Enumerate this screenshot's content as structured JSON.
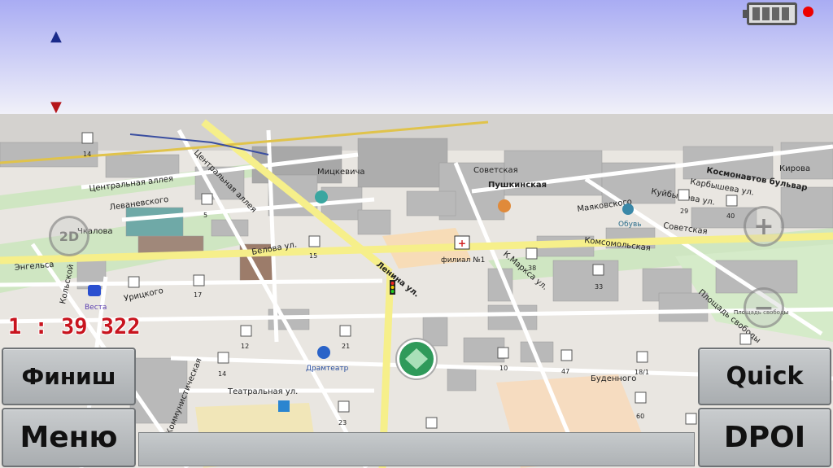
{
  "buttons": {
    "finish": "Финиш",
    "menu": "Меню",
    "quick": "Quick",
    "dpoi": "DPOI"
  },
  "scale": "1 : 39 322",
  "compass": {
    "north": "▲",
    "south": "▼"
  },
  "zoom": {
    "in": "+",
    "out": "−",
    "side": "2D"
  },
  "streets": {
    "centralnaya_alleya": "Центральная аллея",
    "centralnaya_alleya2": "Центральная аллея",
    "levanevskogo": "Леваневского",
    "chkalova": "Чкалова",
    "engelsa": "Энгельса",
    "kolskoy": "Кольской",
    "uritskogo": "Урицкого",
    "belova": "Белова ул.",
    "mitskevicha": "Мицкевича",
    "sovetskaya": "Советская",
    "pushkinskaya": "Пушкинская",
    "mayakovskogo": "Маяковского",
    "komsomolskaya": "Комсомольская",
    "k_marksa": "К.Маркса ул.",
    "lenina": "Ленина ул.",
    "budennogo": "Буденного",
    "teatralnaya": "Театральная ул.",
    "kommunisticheskaya": "Коммунистическая",
    "kosmonavtov": "Космонавтов бульвар",
    "kirova": "Кирова",
    "karbysheva": "Карбышева ул.",
    "kuybysheva": "Куйбышева ул.",
    "sovetskaya2": "Советская",
    "ploshchad_svobody": "Площадь свободы",
    "ploshchad_svobody_small": "Площадь свободы"
  },
  "pois": {
    "vesta": "Веста",
    "filial": "филиал №1",
    "obuv": "Обувь",
    "dramteatr": "Драмтеатр"
  },
  "numbers": [
    "14",
    "5",
    "15",
    "17",
    "12",
    "21",
    "14",
    "23",
    "10",
    "47",
    "18/1",
    "60",
    "29",
    "40",
    "33",
    "38"
  ],
  "colors": {
    "sky_top": "#a9acf3",
    "sky_bottom": "#f1f1f8",
    "ground": "#e9e6e1",
    "road_main": "#f7f08c",
    "park": "#cfe6c2",
    "building": "#b9b9b9",
    "scale_text": "#c8141e",
    "compass": "#1a2a8a",
    "compass_south": "#b5151a"
  }
}
